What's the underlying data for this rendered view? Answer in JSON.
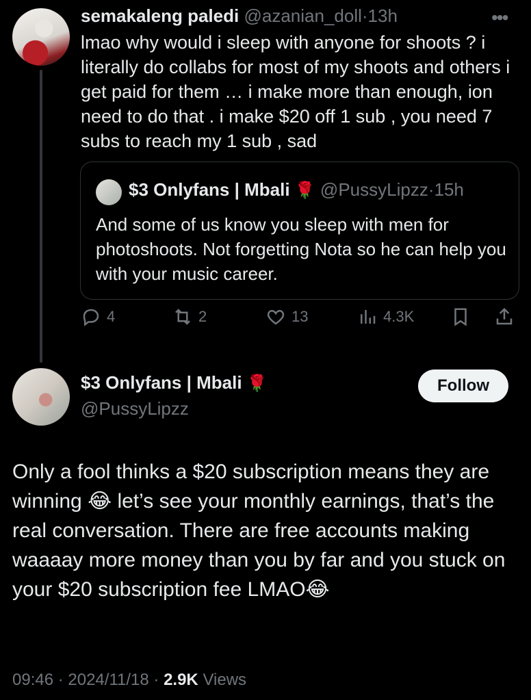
{
  "tweet1": {
    "display_name": "semakaleng paledi",
    "handle": "@azanian_doll",
    "separator": "·",
    "time": "13h",
    "more_icon": "more-icon",
    "text": "lmao why would i sleep with anyone for shoots ? i literally do collabs for most of my shoots and others i get paid for them … i make more than enough, ion need to do that . i make $20 off 1 sub , you need 7 subs to reach my 1 sub , sad",
    "quote": {
      "display_name": "$3 Onlyfans | Mbali",
      "name_emoji": "🌹",
      "handle": "@PussyLipzz",
      "separator": "·",
      "time": "15h",
      "text": "And some of us know you sleep with men for photoshoots.  Not forgetting Nota so he can help you with your music career."
    },
    "actions": {
      "replies": "4",
      "reposts": "2",
      "likes": "13",
      "views": "4.3K"
    }
  },
  "tweet2": {
    "display_name": "$3 Onlyfans | Mbali",
    "name_emoji": "🌹",
    "handle": "@PussyLipzz",
    "follow_label": "Follow",
    "text": "Only a fool thinks  a $20 subscription means they are winning 😂 let’s see your monthly earnings, that’s the real conversation. There are free accounts making waaaay  more money than you by far and you stuck on your $20 subscription fee LMAO😂",
    "meta": {
      "time": "09:46",
      "sep1": " · ",
      "date": "2024/11/18",
      "sep2": " · ",
      "views_count": "2.9K",
      "views_label": "Views"
    }
  },
  "colors": {
    "background": "#000000",
    "text": "#e7e9ea",
    "muted": "#71767b",
    "border": "#2f3336",
    "follow_bg": "#eff3f4"
  }
}
